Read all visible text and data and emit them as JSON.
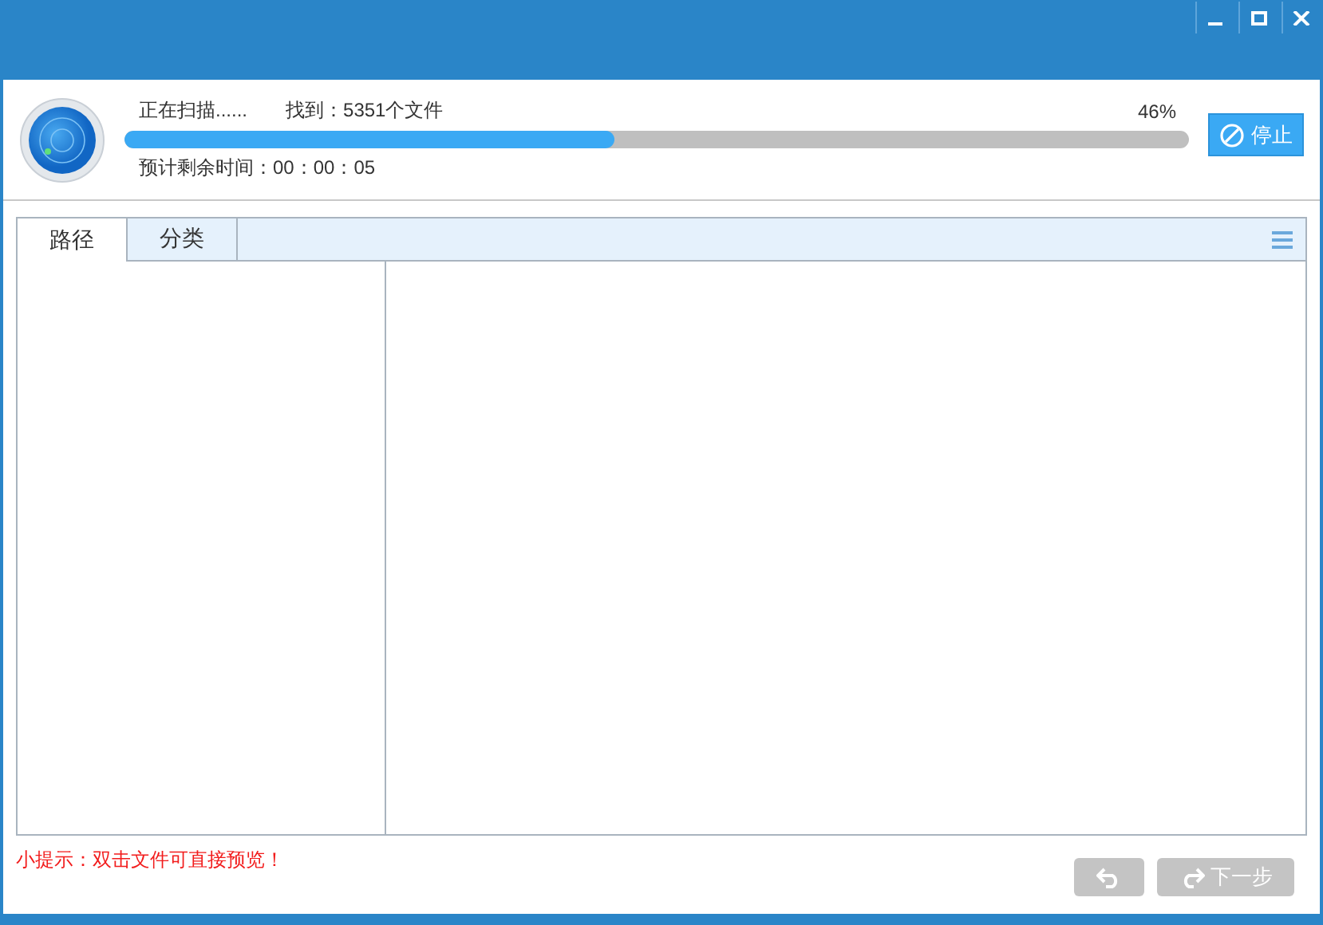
{
  "scan": {
    "status": "正在扫描......",
    "found": "找到：5351个文件",
    "percent": "46%",
    "level": 0.46,
    "remaining": "预计剩余时间：00：00：05",
    "stop_button": "停止"
  },
  "tabs": [
    {
      "label": "路径",
      "selected": true
    },
    {
      "label": "分类",
      "selected": false
    }
  ],
  "hint": "小提示：双击文件可直接预览！",
  "buttons": [
    {
      "kind": "back",
      "disabled": true
    },
    {
      "kind": "next",
      "label": "下一步",
      "disabled": true
    }
  ]
}
